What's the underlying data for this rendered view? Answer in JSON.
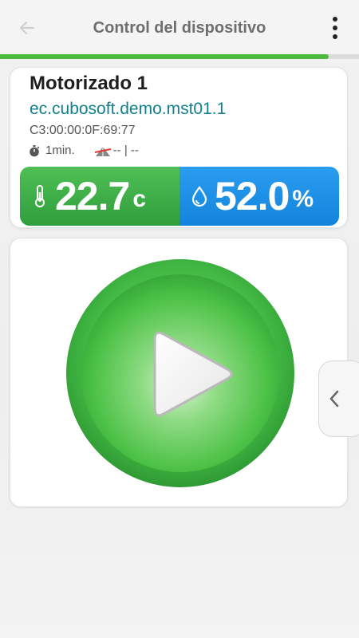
{
  "header": {
    "title": "Control del dispositivo",
    "back_icon": "arrow-left-icon",
    "menu_icon": "more-vertical-icon"
  },
  "progress": {
    "fraction": 0.915,
    "color": "#4cba3d"
  },
  "device": {
    "name": "Motorizado 1",
    "id": "ec.cubosoft.demo.mst01.1",
    "mac": "C3:00:00:0F:69:77",
    "interval": "1min.",
    "signal": "-- | --"
  },
  "readings": {
    "temperature": {
      "value": "22.7",
      "unit": "c",
      "icon": "thermometer-icon",
      "color": "#3aad48"
    },
    "humidity": {
      "value": "52.0",
      "unit": "%",
      "icon": "water-drop-icon",
      "color": "#1f90e6"
    }
  },
  "control": {
    "action_icon": "play-icon",
    "side_tab_icon": "chevron-left-icon"
  }
}
